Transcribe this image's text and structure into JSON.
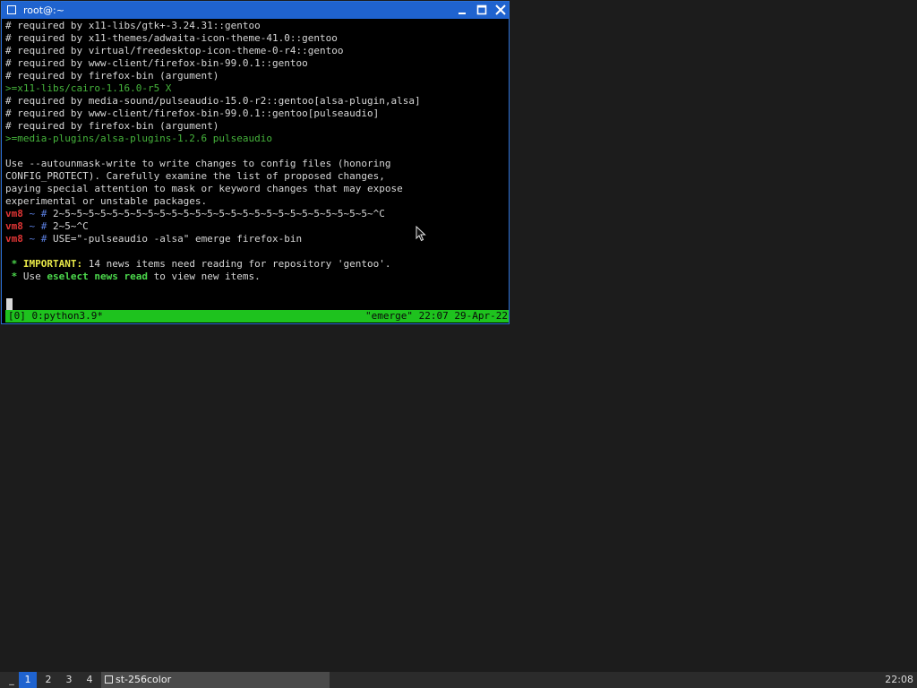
{
  "window": {
    "title": "root@:~",
    "controls": {
      "minimize": "minimize-icon",
      "maximize": "maximize-icon",
      "close": "close-icon"
    },
    "accent": "#1f63cf"
  },
  "terminal": {
    "lines": [
      [
        {
          "c": "w",
          "t": "# required by x11-libs/gtk+-3.24.31::gentoo"
        }
      ],
      [
        {
          "c": "w",
          "t": "# required by x11-themes/adwaita-icon-theme-41.0::gentoo"
        }
      ],
      [
        {
          "c": "w",
          "t": "# required by virtual/freedesktop-icon-theme-0-r4::gentoo"
        }
      ],
      [
        {
          "c": "w",
          "t": "# required by www-client/firefox-bin-99.0.1::gentoo"
        }
      ],
      [
        {
          "c": "w",
          "t": "# required by firefox-bin (argument)"
        }
      ],
      [
        {
          "c": "g",
          "t": ">=x11-libs/cairo-1.16.0-r5 X"
        }
      ],
      [
        {
          "c": "w",
          "t": "# required by media-sound/pulseaudio-15.0-r2::gentoo[alsa-plugin,alsa]"
        }
      ],
      [
        {
          "c": "w",
          "t": "# required by www-client/firefox-bin-99.0.1::gentoo[pulseaudio]"
        }
      ],
      [
        {
          "c": "w",
          "t": "# required by firefox-bin (argument)"
        }
      ],
      [
        {
          "c": "g",
          "t": ">=media-plugins/alsa-plugins-1.2.6 pulseaudio"
        }
      ],
      [
        {
          "c": "w",
          "t": ""
        }
      ],
      [
        {
          "c": "w",
          "t": "Use --autounmask-write to write changes to config files (honoring"
        }
      ],
      [
        {
          "c": "w",
          "t": "CONFIG_PROTECT). Carefully examine the list of proposed changes,"
        }
      ],
      [
        {
          "c": "w",
          "t": "paying special attention to mask or keyword changes that may expose"
        }
      ],
      [
        {
          "c": "w",
          "t": "experimental or unstable packages."
        }
      ],
      [
        {
          "c": "r",
          "t": "vm8"
        },
        {
          "c": "b",
          "t": " ~ # "
        },
        {
          "c": "w",
          "t": "2~5~5~5~5~5~5~5~5~5~5~5~5~5~5~5~5~5~5~5~5~5~5~5~5~5~5~^C"
        }
      ],
      [
        {
          "c": "r",
          "t": "vm8"
        },
        {
          "c": "b",
          "t": " ~ # "
        },
        {
          "c": "w",
          "t": "2~5~^C"
        }
      ],
      [
        {
          "c": "r",
          "t": "vm8"
        },
        {
          "c": "b",
          "t": " ~ # "
        },
        {
          "c": "w",
          "t": "USE=\"-pulseaudio -alsa\" emerge firefox-bin"
        }
      ],
      [
        {
          "c": "w",
          "t": ""
        }
      ],
      [
        {
          "c": "gb",
          "t": " * "
        },
        {
          "c": "y",
          "t": "IMPORTANT:"
        },
        {
          "c": "w",
          "t": " 14 news items need reading for repository 'gentoo'."
        }
      ],
      [
        {
          "c": "gb",
          "t": " * "
        },
        {
          "c": "w",
          "t": "Use "
        },
        {
          "c": "gb",
          "t": "eselect news read"
        },
        {
          "c": "w",
          "t": " to view new items."
        }
      ]
    ]
  },
  "tmux": {
    "left": "[0] 0:python3.9*",
    "right": "\"emerge\" 22:07 29-Apr-22",
    "color": "#1ec21e"
  },
  "panel": {
    "launcher": "_",
    "workspaces": [
      "1",
      "2",
      "3",
      "4"
    ],
    "active_workspace": "1",
    "task": {
      "icon": "window-icon",
      "label": "st-256color"
    },
    "clock": "22:08"
  }
}
